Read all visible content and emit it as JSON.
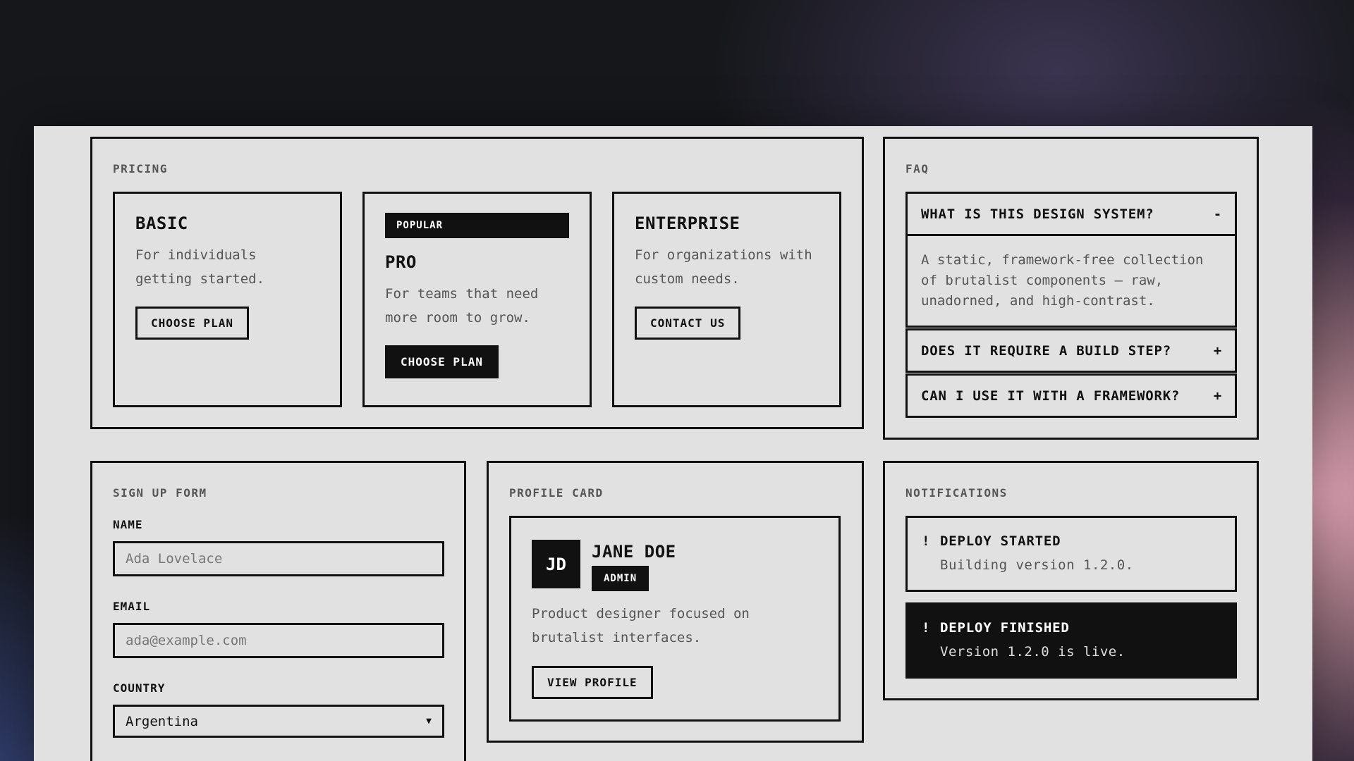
{
  "pricing": {
    "label": "PRICING",
    "plans": [
      {
        "title": "BASIC",
        "description": "For individuals getting started.",
        "button": "CHOOSE PLAN"
      },
      {
        "badge": "POPULAR",
        "title": "PRO",
        "description": "For teams that need more room to grow.",
        "button": "CHOOSE PLAN"
      },
      {
        "title": "ENTERPRISE",
        "description": "For organizations with custom needs.",
        "button": "CONTACT US"
      }
    ]
  },
  "faq": {
    "label": "FAQ",
    "items": [
      {
        "question": "WHAT IS THIS DESIGN SYSTEM?",
        "toggle": "-",
        "answer": "A static, framework-free collection of brutalist components — raw, unadorned, and high-contrast."
      },
      {
        "question": "DOES IT REQUIRE A BUILD STEP?",
        "toggle": "+"
      },
      {
        "question": "CAN I USE IT WITH A FRAMEWORK?",
        "toggle": "+"
      }
    ]
  },
  "signup": {
    "label": "SIGN UP FORM",
    "name_label": "NAME",
    "name_placeholder": "Ada Lovelace",
    "email_label": "EMAIL",
    "email_placeholder": "ada@example.com",
    "country_label": "COUNTRY",
    "country_value": "Argentina"
  },
  "profile": {
    "label": "PROFILE CARD",
    "initials": "JD",
    "name": "JANE DOE",
    "role": "ADMIN",
    "bio": "Product designer focused on brutalist interfaces.",
    "button": "VIEW PROFILE"
  },
  "notifications": {
    "label": "NOTIFICATIONS",
    "items": [
      {
        "icon": "!",
        "title": "DEPLOY STARTED",
        "message": "Building version 1.2.0."
      },
      {
        "icon": "!",
        "title": "DEPLOY FINISHED",
        "message": "Version 1.2.0 is live."
      }
    ]
  }
}
